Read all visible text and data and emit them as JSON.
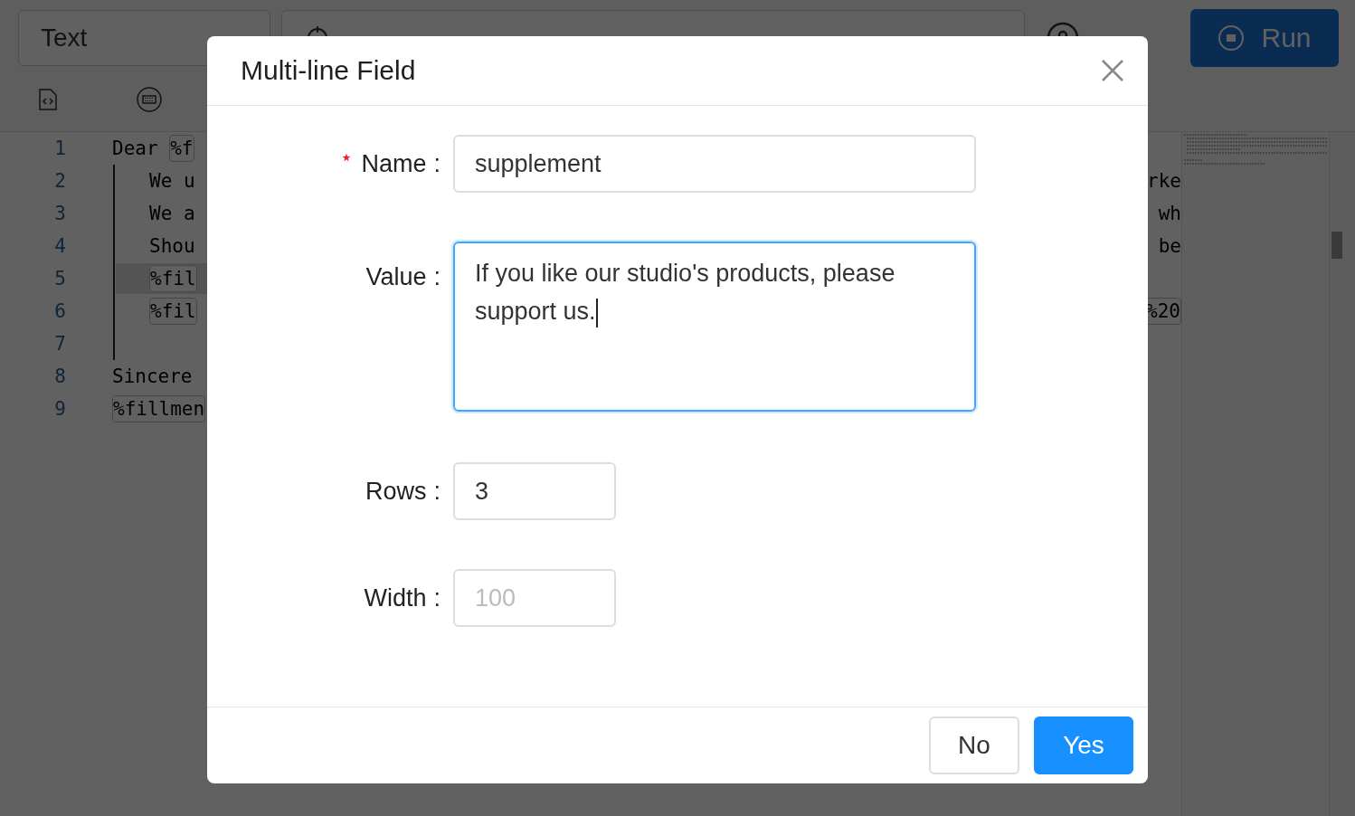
{
  "toolbar": {
    "type_select": {
      "value": "Text"
    },
    "run_button": {
      "label": "Run"
    }
  },
  "editor": {
    "lines": [
      {
        "number": "1",
        "indent": false,
        "active": false,
        "left": [
          {
            "kind": "text",
            "text": "Dear "
          },
          {
            "kind": "chip",
            "text": "%f"
          }
        ]
      },
      {
        "number": "2",
        "indent": true,
        "active": false,
        "left": [
          {
            "kind": "text",
            "text": "We u"
          }
        ],
        "right": [
          {
            "kind": "text",
            "text": "rke"
          }
        ]
      },
      {
        "number": "3",
        "indent": true,
        "active": false,
        "left": [
          {
            "kind": "text",
            "text": "We a"
          }
        ],
        "right": [
          {
            "kind": "text",
            "text": "wh"
          }
        ]
      },
      {
        "number": "4",
        "indent": true,
        "active": false,
        "left": [
          {
            "kind": "text",
            "text": "Shou"
          }
        ],
        "right": [
          {
            "kind": "text",
            "text": "be"
          }
        ]
      },
      {
        "number": "5",
        "indent": true,
        "active": true,
        "left": [
          {
            "kind": "chip",
            "text": "%fil"
          }
        ]
      },
      {
        "number": "6",
        "indent": true,
        "active": false,
        "left": [
          {
            "kind": "chip",
            "text": "%fil"
          }
        ],
        "right": [
          {
            "kind": "chip",
            "text": "%20"
          }
        ]
      },
      {
        "number": "7",
        "indent": true,
        "active": false
      },
      {
        "number": "8",
        "indent": false,
        "active": false,
        "left": [
          {
            "kind": "text",
            "text": "Sincere"
          }
        ]
      },
      {
        "number": "9",
        "indent": false,
        "active": false,
        "left": [
          {
            "kind": "chip",
            "text": "%fillmen"
          }
        ]
      }
    ]
  },
  "dialog": {
    "title": "Multi-line Field",
    "fields": [
      {
        "kind": "text",
        "label": "Name",
        "colon": ":",
        "required": true,
        "focused": false,
        "value": "supplement"
      },
      {
        "kind": "textarea",
        "label": "Value",
        "colon": ":",
        "required": false,
        "focused": true,
        "value": "If you like our studio's products, please support us."
      },
      {
        "kind": "number",
        "label": "Rows",
        "colon": ":",
        "required": false,
        "focused": false,
        "value": "3"
      },
      {
        "kind": "number",
        "label": "Width",
        "colon": ":",
        "required": false,
        "focused": false,
        "placeholder": "100"
      }
    ],
    "buttons": [
      {
        "label": "No",
        "primary": false
      },
      {
        "label": "Yes",
        "primary": true
      }
    ]
  }
}
